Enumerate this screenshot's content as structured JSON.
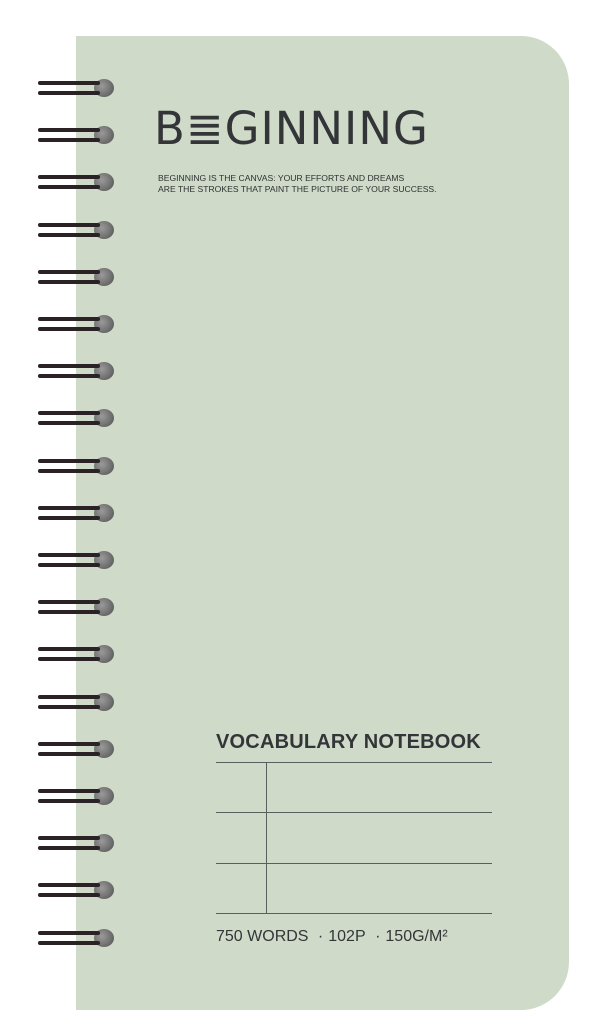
{
  "cover": {
    "background_color": "#cfdac8",
    "brand": "B≣GINNING",
    "tagline_lines": [
      "BEGINNING IS THE CANVAS: YOUR EFFORTS AND DREAMS",
      "ARE THE STROKES THAT PAINT THE PICTURE OF YOUR SUCCESS."
    ],
    "vocab_title": "VOCABULARY NOTEBOOK",
    "specs": {
      "words": "750 WORDS",
      "sep1": "·",
      "pages": "102P",
      "sep2": "·",
      "weight": "150G/M²"
    }
  },
  "spiral": {
    "coil_count": 19,
    "wire_color": "#2a2224",
    "icon": "spiral-binding-icon"
  }
}
